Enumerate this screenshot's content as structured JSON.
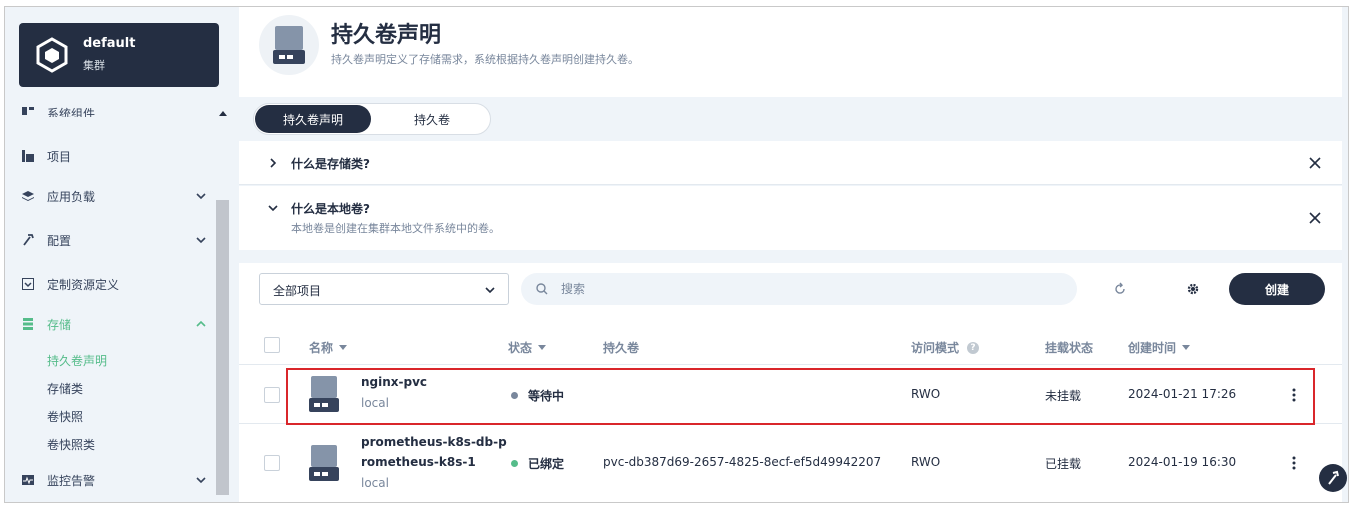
{
  "cluster": {
    "name": "default",
    "type": "集群"
  },
  "sidebar": {
    "items": [
      {
        "label": "系统组件",
        "icon": "components-icon"
      },
      {
        "label": "项目",
        "icon": "project-icon"
      },
      {
        "label": "应用负载",
        "icon": "workload-icon"
      },
      {
        "label": "配置",
        "icon": "config-icon"
      },
      {
        "label": "定制资源定义",
        "icon": "crd-icon"
      },
      {
        "label": "存储",
        "icon": "storage-icon"
      },
      {
        "label": "监控告警",
        "icon": "monitoring-icon"
      }
    ],
    "storage_sub": [
      "持久卷声明",
      "存储类",
      "卷快照",
      "卷快照类"
    ]
  },
  "header": {
    "title": "持久卷声明",
    "description": "持久卷声明定义了存储需求，系统根据持久卷声明创建持久卷。"
  },
  "tabs": [
    "持久卷声明",
    "持久卷"
  ],
  "faq": [
    {
      "question": "什么是存储类?",
      "answer": ""
    },
    {
      "question": "什么是本地卷?",
      "answer": "本地卷是创建在集群本地文件系统中的卷。"
    }
  ],
  "toolbar": {
    "project_select": "全部项目",
    "search_placeholder": "搜索",
    "create_label": "创建"
  },
  "table": {
    "columns": [
      "名称",
      "状态",
      "持久卷",
      "访问模式",
      "挂载状态",
      "创建时间"
    ],
    "rows": [
      {
        "name": "nginx-pvc",
        "name_line2": "",
        "class": "local",
        "status": "等待中",
        "status_color": "#79879c",
        "volume": "",
        "access": "RWO",
        "mount": "未挂载",
        "created": "2024-01-21 17:26"
      },
      {
        "name": "prometheus-k8s-db-p",
        "name_line2": "rometheus-k8s-1",
        "class": "local",
        "status": "已绑定",
        "status_color": "#55bc8a",
        "volume": "pvc-db387d69-2657-4825-8ecf-ef5d49942207",
        "access": "RWO",
        "mount": "已挂载",
        "created": "2024-01-19 16:30"
      }
    ]
  },
  "colors": {
    "accent": "#55bc8a",
    "dark": "#242e42",
    "highlight": "#d9262b"
  }
}
